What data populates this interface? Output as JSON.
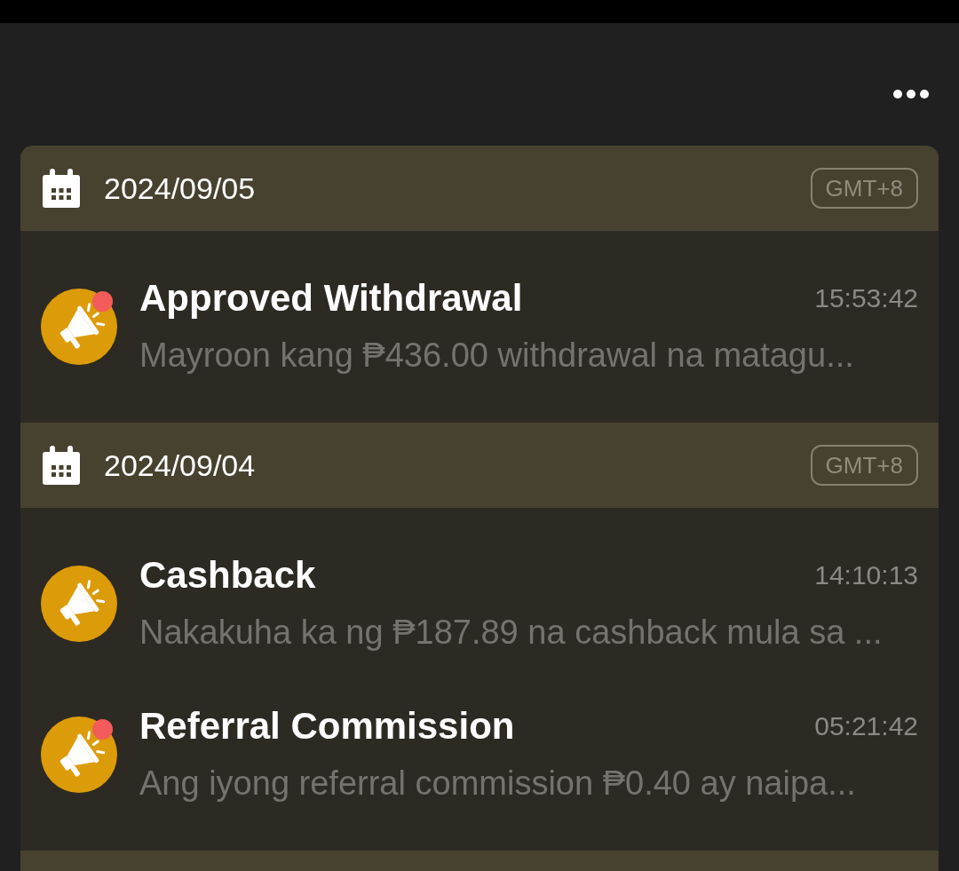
{
  "groups": [
    {
      "date": "2024/09/05",
      "timezone": "GMT+8",
      "notifications": [
        {
          "title": "Approved Withdrawal",
          "time": "15:53:42",
          "message": "Mayroon kang ₱436.00 withdrawal na matagu...",
          "unread": true
        }
      ]
    },
    {
      "date": "2024/09/04",
      "timezone": "GMT+8",
      "notifications": [
        {
          "title": "Cashback",
          "time": "14:10:13",
          "message": "Nakakuha ka ng ₱187.89 na cashback mula sa ...",
          "unread": false
        },
        {
          "title": "Referral Commission",
          "time": "05:21:42",
          "message": "Ang iyong referral commission ₱0.40 ay naipa...",
          "unread": true
        }
      ]
    }
  ]
}
